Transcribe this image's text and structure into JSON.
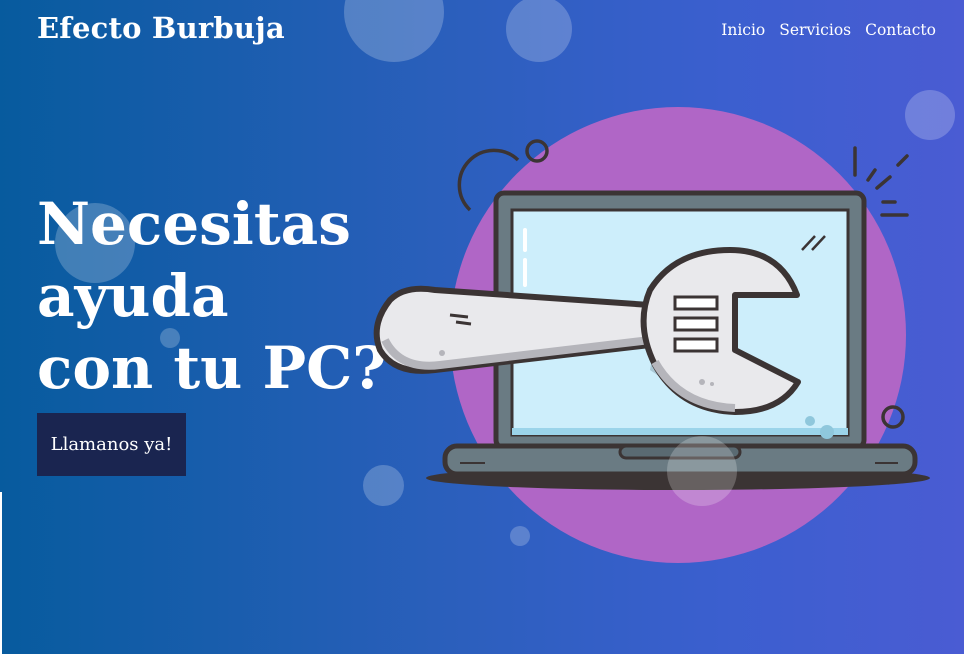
{
  "header": {
    "logo": "Efecto Burbuja",
    "nav": [
      {
        "label": "Inicio"
      },
      {
        "label": "Servicios"
      },
      {
        "label": "Contacto"
      }
    ]
  },
  "hero": {
    "headline_lines": [
      "Necesitas",
      "ayuda",
      "con tu PC?"
    ],
    "cta_label": "Llamanos ya!",
    "illustration_icon": "laptop-wrench-icon"
  },
  "colors": {
    "gradient_start": "#075b9e",
    "gradient_end": "#4a5cd3",
    "cta_background": "#1a2550",
    "illustration_circle": "#b066c6",
    "screen": "#cdeefb"
  }
}
